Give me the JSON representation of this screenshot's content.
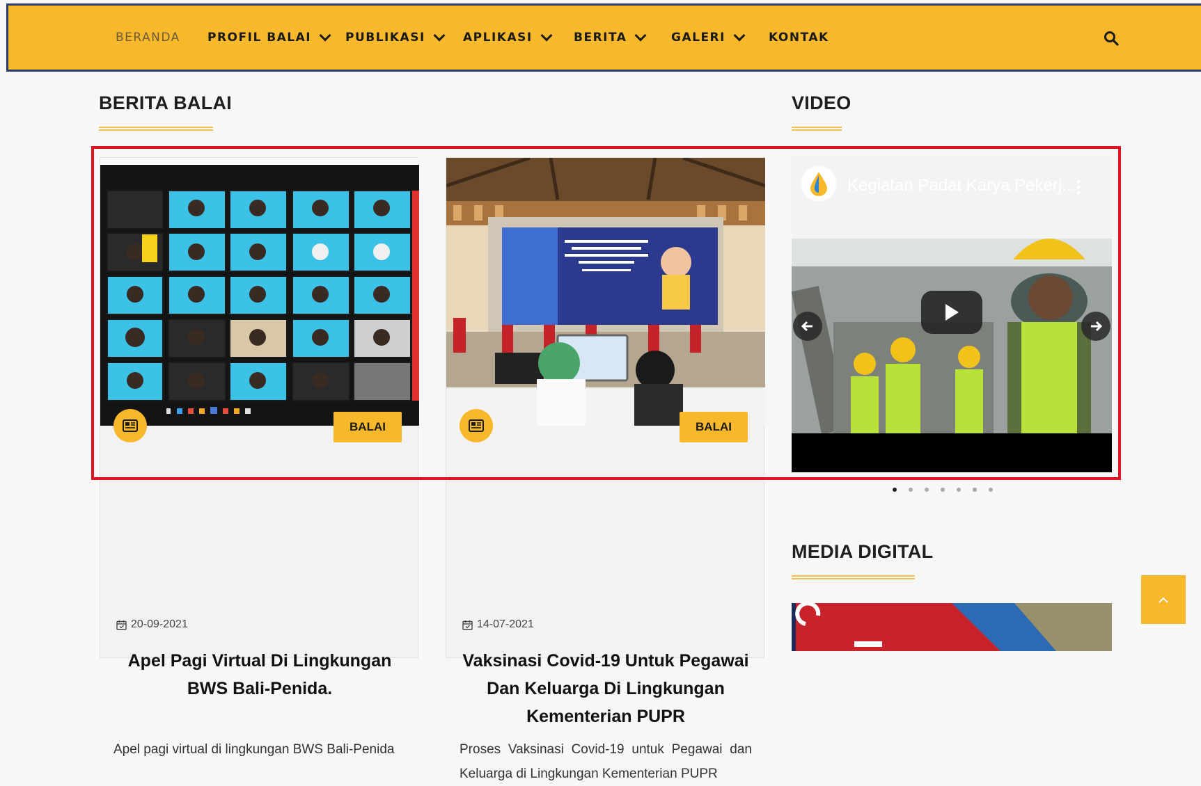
{
  "nav": {
    "items": [
      {
        "label": "BERANDA",
        "dropdown": false,
        "active": true
      },
      {
        "label": "PROFIL BALAI",
        "dropdown": true
      },
      {
        "label": "PUBLIKASI",
        "dropdown": true
      },
      {
        "label": "APLIKASI",
        "dropdown": true
      },
      {
        "label": "BERITA",
        "dropdown": true
      },
      {
        "label": "GALERI",
        "dropdown": true
      },
      {
        "label": "KONTAK",
        "dropdown": false
      }
    ],
    "search_icon": "search-icon"
  },
  "sections": {
    "berita": "BERITA BALAI",
    "video": "VIDEO",
    "media": "MEDIA DIGITAL"
  },
  "cards": [
    {
      "category": "BALAI",
      "date": "20-09-2021",
      "title": "Apel Pagi Virtual Di Lingkungan BWS Bali-Penida.",
      "excerpt": "Apel pagi virtual di lingkungan BWS Bali-Penida"
    },
    {
      "category": "BALAI",
      "date": "14-07-2021",
      "title": "Vaksinasi Covid-19 Untuk Pegawai Dan Keluarga Di Lingkungan Kementerian PUPR",
      "excerpt": "Proses Vaksinasi Covid-19 untuk Pegawai dan Keluarga di Lingkungan Kementerian PUPR"
    }
  ],
  "video": {
    "title": "Kegiatan Padat Karya Pekerj..."
  },
  "colors": {
    "accent": "#f7b82b",
    "nav_border": "#2b3a6b",
    "highlight": "#e01422"
  }
}
